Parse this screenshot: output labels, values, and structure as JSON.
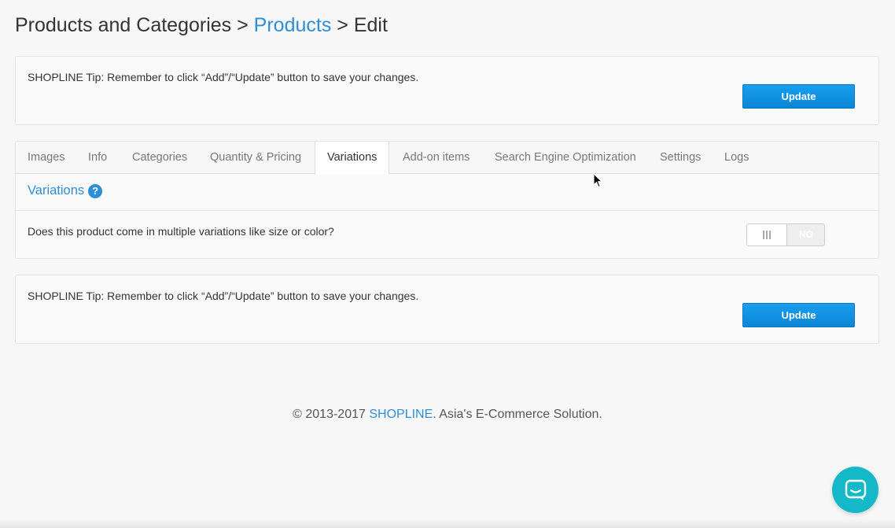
{
  "breadcrumb": {
    "part1": "Products and Categories",
    "sep1": " > ",
    "part2": "Products",
    "sep2": " > ",
    "part3": "Edit"
  },
  "top_tip": {
    "text": "SHOPLINE Tip: Remember to click “Add”/“Update” button to save your changes.",
    "button_label": "Update"
  },
  "tabs": [
    {
      "label": "Images"
    },
    {
      "label": "Info"
    },
    {
      "label": "Categories"
    },
    {
      "label": "Quantity & Pricing"
    },
    {
      "label": "Variations",
      "active": true
    },
    {
      "label": "Add-on items"
    },
    {
      "label": "Search Engine Optimization"
    },
    {
      "label": "Settings"
    },
    {
      "label": "Logs"
    }
  ],
  "variations": {
    "title": "Variations",
    "help_glyph": "?",
    "question": "Does this product come in multiple variations like size or color?",
    "toggle_label": "NO",
    "toggle_on": false
  },
  "bottom_tip": {
    "text": "SHOPLINE Tip: Remember to click “Add”/“Update” button to save your changes.",
    "button_label": "Update"
  },
  "footer": {
    "prefix": "© 2013-2017 ",
    "brand": "SHOPLINE",
    "suffix": ". Asia's E-Commerce Solution."
  },
  "colors": {
    "accent": "#2e8ed6",
    "button": "#0b86d6",
    "chat": "#14b8c8"
  },
  "icons": {
    "help": "help-icon",
    "chat": "chat-icon",
    "cursor": "mouse-cursor-icon"
  }
}
